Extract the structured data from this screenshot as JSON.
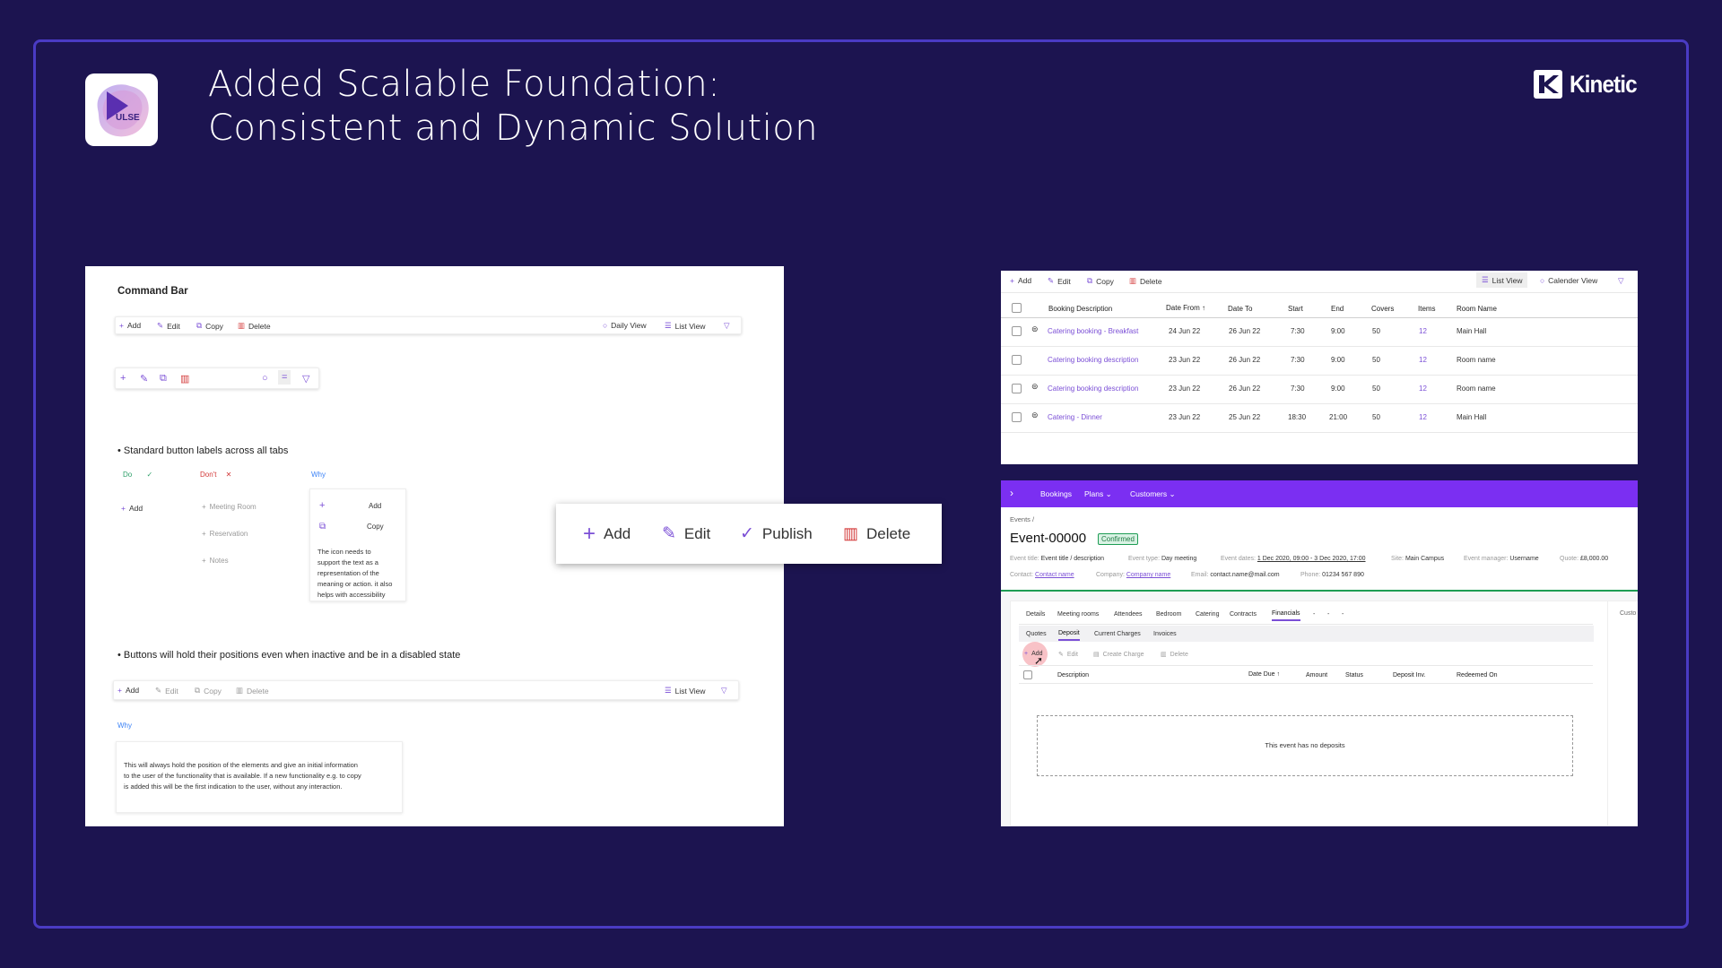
{
  "slide": {
    "title_line1": "Added Scalable Foundation:",
    "title_line2": "Consistent and Dynamic Solution",
    "logo_text": "ULSE",
    "brand_name": "Kinetic",
    "colors": {
      "background": "#1c1450",
      "frame": "#4a3bc4",
      "accent": "#7b2ff2",
      "delete": "#d33a3a"
    }
  },
  "command_bar_doc": {
    "heading": "Command Bar",
    "toolbar": {
      "add": "Add",
      "edit": "Edit",
      "copy": "Copy",
      "delete": "Delete",
      "daily_view": "Daily View",
      "list_view": "List View"
    },
    "bullet1": "Standard button labels across all tabs",
    "do_label": "Do",
    "dont_label": "Don't",
    "why_label": "Why",
    "do_example": "Add",
    "dont_examples": [
      "Meeting Room",
      "Reservation",
      "Notes"
    ],
    "why_examples": [
      "Add",
      "Copy"
    ],
    "why_text": [
      "The icon needs to",
      "support the text as a",
      "representation of the",
      "meaning or action. it also",
      "helps with accessibility"
    ],
    "bullet2": "Buttons will hold their positions even when inactive and be in a disabled state",
    "disabled_toolbar": {
      "add": "Add",
      "edit": "Edit",
      "copy": "Copy",
      "delete": "Delete",
      "list_view": "List View"
    },
    "why2_label": "Why",
    "why2_text": [
      "This will always hold the position of the elements and give an initial information",
      "to the user of the functionality that is available. If a new functionality e.g. to copy",
      "is added this will be the first indication to the user, without any interaction."
    ]
  },
  "big_toolbar": {
    "add": "Add",
    "edit": "Edit",
    "publish": "Publish",
    "delete": "Delete"
  },
  "bookings_table": {
    "toolbar": {
      "add": "Add",
      "edit": "Edit",
      "copy": "Copy",
      "delete": "Delete",
      "list_view": "List View",
      "calendar_view": "Calender View"
    },
    "columns": [
      "Booking Description",
      "Date From",
      "Date To",
      "Start",
      "End",
      "Covers",
      "Items",
      "Room Name"
    ],
    "rows": [
      [
        "Catering booking - Breakfast",
        "24 Jun 22",
        "26 Jun 22",
        "7:30",
        "9:00",
        "50",
        "12",
        "Main Hall"
      ],
      [
        "Catering booking description",
        "23 Jun 22",
        "26 Jun 22",
        "7:30",
        "9:00",
        "50",
        "12",
        "Room name"
      ],
      [
        "Catering booking description",
        "23 Jun 22",
        "26 Jun 22",
        "7:30",
        "9:00",
        "50",
        "12",
        "Room name"
      ],
      [
        "Catering - Dinner",
        "23 Jun 22",
        "25 Jun 22",
        "18:30",
        "21:00",
        "50",
        "12",
        "Main Hall"
      ]
    ]
  },
  "event_page": {
    "nav": [
      "Bookings",
      "Plans",
      "Customers"
    ],
    "breadcrumb": "Events /",
    "event_id": "Event-00000",
    "status": "Confirmed",
    "meta1": [
      [
        "Event title:",
        "Event title / description"
      ],
      [
        "Event type:",
        "Day meeting"
      ],
      [
        "Event dates:",
        "1 Dec 2020, 09:00 - 3 Dec 2020, 17:00"
      ],
      [
        "Site:",
        "Main Campus"
      ],
      [
        "Event manager:",
        "Username"
      ],
      [
        "Quote:",
        "£8,000.00"
      ]
    ],
    "meta2": [
      [
        "Contact:",
        "Contact name"
      ],
      [
        "Company:",
        "Company name"
      ],
      [
        "Email:",
        "contact.name@mail.com"
      ],
      [
        "Phone:",
        "01234 567 890"
      ]
    ],
    "tabs": [
      "Details",
      "Meeting rooms",
      "Attendees",
      "Bedroom",
      "Catering",
      "Contracts",
      "Financials",
      "-",
      "-",
      "-"
    ],
    "side_label": "Custo",
    "subtabs": [
      "Quotes",
      "Deposit",
      "Current Charges",
      "Invoices"
    ],
    "toolbar": {
      "add": "Add",
      "edit": "Edit",
      "create_charges": "Create Charge",
      "delete": "Delete"
    },
    "columns": [
      "Description",
      "Date Due",
      "Amount",
      "Status",
      "Deposit Inv.",
      "Redeemed On"
    ],
    "empty_message": "This event has no deposits"
  }
}
